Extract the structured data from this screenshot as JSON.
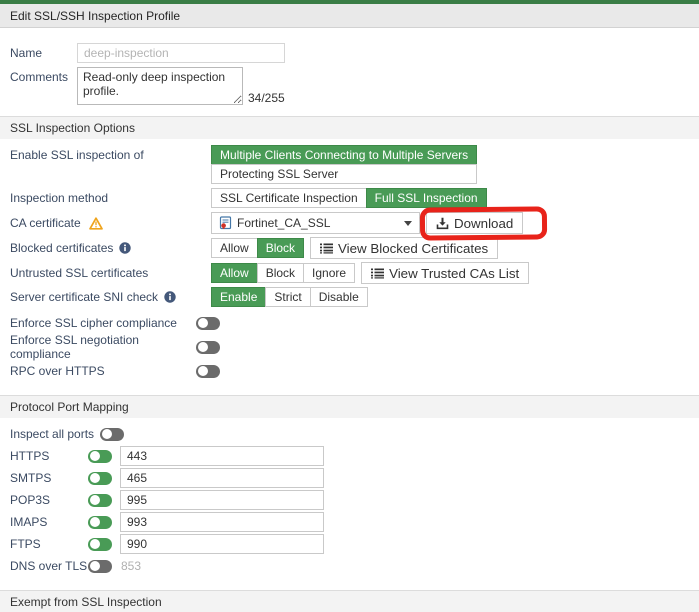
{
  "colors": {
    "accent_green": "#499b56",
    "topbar_green": "#3a7d46",
    "annotation_red": "#e8231a"
  },
  "header": {
    "title": "Edit SSL/SSH Inspection Profile"
  },
  "basic": {
    "name_label": "Name",
    "name_value": "deep-inspection",
    "comments_label": "Comments",
    "comments_value": "Read-only deep inspection profile.",
    "comments_counter": "34/255"
  },
  "ssl_options": {
    "title": "SSL Inspection Options",
    "enable_row": {
      "label": "Enable SSL inspection of",
      "options": [
        "Multiple Clients Connecting to Multiple Servers",
        "Protecting SSL Server"
      ],
      "selected": "Multiple Clients Connecting to Multiple Servers"
    },
    "method_row": {
      "label": "Inspection method",
      "options": [
        "SSL Certificate Inspection",
        "Full SSL Inspection"
      ],
      "selected": "Full SSL Inspection"
    },
    "ca_row": {
      "label": "CA certificate",
      "value": "Fortinet_CA_SSL",
      "download_label": "Download"
    },
    "blocked_row": {
      "label": "Blocked certificates",
      "options": [
        "Allow",
        "Block"
      ],
      "selected": "Block",
      "view_button": "View Blocked Certificates"
    },
    "untrusted_row": {
      "label": "Untrusted SSL certificates",
      "options": [
        "Allow",
        "Block",
        "Ignore"
      ],
      "selected": "Allow",
      "view_button": "View Trusted CAs List"
    },
    "sni_row": {
      "label": "Server certificate SNI check",
      "options": [
        "Enable",
        "Strict",
        "Disable"
      ],
      "selected": "Enable"
    },
    "toggles": [
      {
        "label": "Enforce SSL cipher compliance",
        "state": "off"
      },
      {
        "label": "Enforce SSL negotiation compliance",
        "state": "off"
      },
      {
        "label": "RPC over HTTPS",
        "state": "off"
      }
    ]
  },
  "port_mapping": {
    "title": "Protocol Port Mapping",
    "inspect_all": {
      "label": "Inspect all ports",
      "state": "off"
    },
    "ports": [
      {
        "label": "HTTPS",
        "state": "on",
        "value": "443"
      },
      {
        "label": "SMTPS",
        "state": "on",
        "value": "465"
      },
      {
        "label": "POP3S",
        "state": "on",
        "value": "995"
      },
      {
        "label": "IMAPS",
        "state": "on",
        "value": "993"
      },
      {
        "label": "FTPS",
        "state": "on",
        "value": "990"
      },
      {
        "label": "DNS over TLS",
        "state": "off",
        "value": "853"
      }
    ]
  },
  "exempt": {
    "title": "Exempt from SSL Inspection"
  },
  "icons": {
    "warning": "warning-icon",
    "info": "info-icon",
    "certificate": "certificate-icon",
    "chevron_down": "chevron-down-icon",
    "download": "download-icon",
    "list": "list-icon"
  }
}
